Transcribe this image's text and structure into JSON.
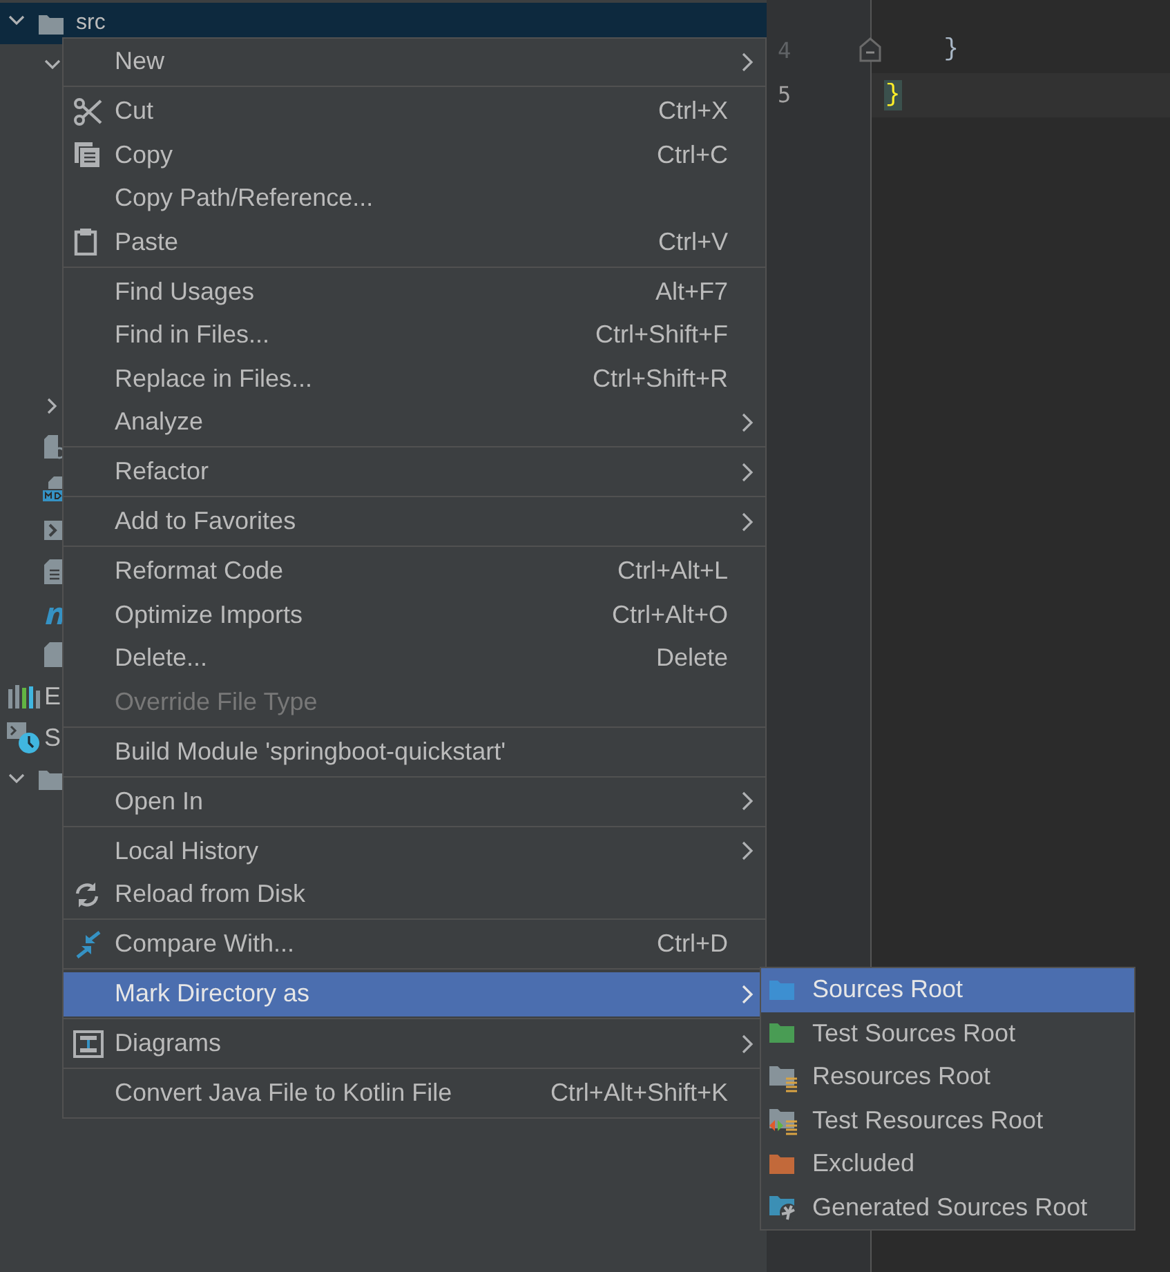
{
  "project_tree": {
    "top": [
      {
        "kind": "folder",
        "name": "src",
        "expanded": true,
        "selected": true,
        "children": [
          {
            "expanded": true
          }
        ]
      }
    ],
    "bottom": [
      {
        "kind": "covered",
        "children": [
          {
            "expanded": false
          },
          {
            "kind": "file-gear"
          },
          {
            "kind": "file-md"
          },
          {
            "kind": "terminal-file"
          },
          {
            "kind": "text-file"
          },
          {
            "kind": "maven"
          },
          {
            "kind": "file"
          }
        ]
      },
      {
        "kind": "libraries",
        "name": "E"
      },
      {
        "kind": "scratches",
        "name": "S"
      },
      {
        "kind": "folder",
        "expanded": true
      }
    ]
  },
  "editor": {
    "lines": [
      {
        "number": "4",
        "code": "    }",
        "current": false,
        "foldable": true
      },
      {
        "number": "5",
        "code": "}",
        "current": true,
        "highlighted": true
      }
    ]
  },
  "context_menu": {
    "items": [
      {
        "kind": "plain",
        "label": "New",
        "submenu": true,
        "selected": false,
        "disabled": false
      },
      {
        "kind": "separator"
      },
      {
        "kind": "scissors",
        "label": "Cut",
        "shortcut": "Ctrl+X",
        "selected": false,
        "disabled": false
      },
      {
        "kind": "copy",
        "label": "Copy",
        "shortcut": "Ctrl+C",
        "selected": false,
        "disabled": false
      },
      {
        "kind": "plain",
        "label": "Copy Path/Reference...",
        "selected": false,
        "disabled": false
      },
      {
        "kind": "clipboard",
        "label": "Paste",
        "shortcut": "Ctrl+V",
        "selected": false,
        "disabled": false
      },
      {
        "kind": "separator"
      },
      {
        "kind": "plain",
        "label": "Find Usages",
        "shortcut": "Alt+F7",
        "selected": false,
        "disabled": false
      },
      {
        "kind": "plain",
        "label": "Find in Files...",
        "shortcut": "Ctrl+Shift+F",
        "selected": false,
        "disabled": false
      },
      {
        "kind": "plain",
        "label": "Replace in Files...",
        "shortcut": "Ctrl+Shift+R",
        "selected": false,
        "disabled": false
      },
      {
        "kind": "plain",
        "label": "Analyze",
        "submenu": true,
        "selected": false,
        "disabled": false
      },
      {
        "kind": "separator"
      },
      {
        "kind": "plain",
        "label": "Refactor",
        "submenu": true,
        "selected": false,
        "disabled": false
      },
      {
        "kind": "separator"
      },
      {
        "kind": "plain",
        "label": "Add to Favorites",
        "submenu": true,
        "selected": false,
        "disabled": false
      },
      {
        "kind": "separator"
      },
      {
        "kind": "plain",
        "label": "Reformat Code",
        "shortcut": "Ctrl+Alt+L",
        "selected": false,
        "disabled": false
      },
      {
        "kind": "plain",
        "label": "Optimize Imports",
        "shortcut": "Ctrl+Alt+O",
        "selected": false,
        "disabled": false
      },
      {
        "kind": "plain",
        "label": "Delete...",
        "shortcut": "Delete",
        "selected": false,
        "disabled": false
      },
      {
        "kind": "plain",
        "label": "Override File Type",
        "selected": false,
        "disabled": true
      },
      {
        "kind": "separator"
      },
      {
        "kind": "plain",
        "label": "Build Module 'springboot-quickstart'",
        "selected": false,
        "disabled": false
      },
      {
        "kind": "separator"
      },
      {
        "kind": "plain",
        "label": "Open In",
        "submenu": true,
        "selected": false,
        "disabled": false
      },
      {
        "kind": "separator"
      },
      {
        "kind": "plain",
        "label": "Local History",
        "submenu": true,
        "selected": false,
        "disabled": false
      },
      {
        "kind": "reload",
        "label": "Reload from Disk",
        "selected": false,
        "disabled": false
      },
      {
        "kind": "separator"
      },
      {
        "kind": "compare",
        "label": "Compare With...",
        "shortcut": "Ctrl+D",
        "selected": false,
        "disabled": false
      },
      {
        "kind": "separator"
      },
      {
        "kind": "plain",
        "label": "Mark Directory as",
        "submenu": true,
        "selected": true,
        "disabled": false
      },
      {
        "kind": "separator"
      },
      {
        "kind": "diagram",
        "label": "Diagrams",
        "submenu": true,
        "selected": false,
        "disabled": false
      },
      {
        "kind": "separator"
      },
      {
        "kind": "plain",
        "label": "Convert Java File to Kotlin File",
        "shortcut": "Ctrl+Alt+Shift+K",
        "selected": false,
        "disabled": false
      }
    ]
  },
  "submenu": {
    "items": [
      {
        "kind": "folder",
        "label": "Sources Root",
        "selected": true,
        "color": "#3d8fd1"
      },
      {
        "kind": "folder",
        "label": "Test Sources Root",
        "selected": false,
        "color": "#499c54"
      },
      {
        "kind": "resources",
        "label": "Resources Root",
        "selected": false,
        "color": "#87939a"
      },
      {
        "kind": "test-resources",
        "label": "Test Resources Root",
        "selected": false,
        "color": "#87939a"
      },
      {
        "kind": "folder",
        "label": "Excluded",
        "selected": false,
        "color": "#c2693a"
      },
      {
        "kind": "generated",
        "label": "Generated Sources Root",
        "selected": false,
        "color": "#3b8fb5"
      }
    ]
  }
}
